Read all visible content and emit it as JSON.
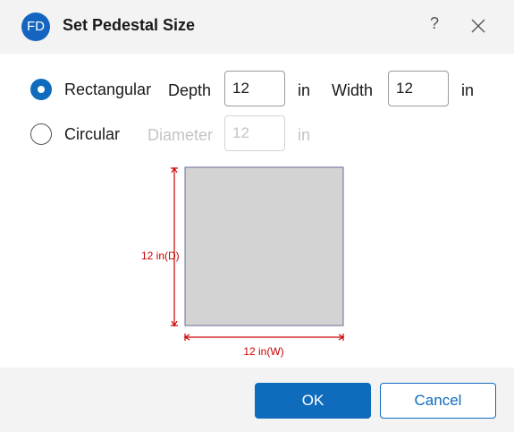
{
  "window": {
    "logo_text": "FD",
    "title": "Set Pedestal Size",
    "help_label": "?",
    "close_icon": "close-icon"
  },
  "shape": {
    "rectangular": {
      "label": "Rectangular",
      "selected": true,
      "depth_label": "Depth",
      "depth_value": "12",
      "depth_unit": "in",
      "width_label": "Width",
      "width_value": "12",
      "width_unit": "in"
    },
    "circular": {
      "label": "Circular",
      "selected": false,
      "diameter_label": "Diameter",
      "diameter_value": "12",
      "diameter_unit": "in"
    }
  },
  "preview": {
    "depth_dim_label": "12 in(D)",
    "width_dim_label": "12 in(W)",
    "fill_color": "#d3d3d3",
    "outline_color": "#6b6b9a",
    "dimension_color": "#cc0000"
  },
  "footer": {
    "ok_label": "OK",
    "cancel_label": "Cancel"
  },
  "colors": {
    "accent": "#0f6cbd",
    "logo": "#1565c0"
  }
}
